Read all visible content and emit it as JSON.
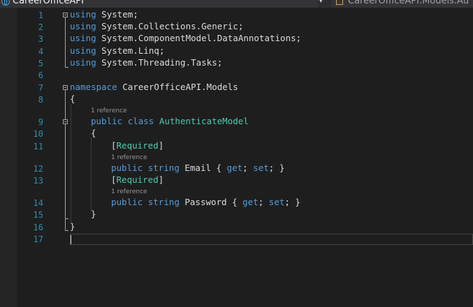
{
  "nav": {
    "project": "CareerOfficeAPI",
    "member": "CareerOfficeAPI.Models.Au"
  },
  "gutter": [
    "1",
    "2",
    "3",
    "4",
    "5",
    "6",
    "7",
    "8",
    "9",
    "10",
    "11",
    "12",
    "13",
    "14",
    "15",
    "16",
    "17"
  ],
  "code": {
    "l1": {
      "kw": "using",
      "rest": " System;"
    },
    "l2": {
      "kw": "using",
      "rest": " System.Collections.Generic;"
    },
    "l3": {
      "kw": "using",
      "rest": " System.ComponentModel.DataAnnotations;"
    },
    "l4": {
      "kw": "using",
      "rest": " System.Linq;"
    },
    "l5": {
      "kw": "using",
      "rest": " System.Threading.Tasks;"
    },
    "l7": {
      "kw": "namespace",
      "rest": " CareerOfficeAPI.Models"
    },
    "l8": {
      "text": "{"
    },
    "l9": {
      "kw1": "public",
      "kw2": "class",
      "type": "AuthenticateModel"
    },
    "l10": {
      "text": "{"
    },
    "l11": {
      "open": "[",
      "attr": "Required",
      "close": "]"
    },
    "l12": {
      "kw1": "public",
      "kw2": "string",
      "name": " Email { ",
      "get": "get",
      "mid": "; ",
      "set": "set",
      "end": "; }"
    },
    "l13": {
      "open": "[",
      "attr": "Required",
      "close": "]"
    },
    "l14": {
      "kw1": "public",
      "kw2": "string",
      "name": " Password { ",
      "get": "get",
      "mid": "; ",
      "set": "set",
      "end": "; }"
    },
    "l15": {
      "text": "}"
    },
    "l16": {
      "text": "}"
    }
  },
  "lens": {
    "class_refs": "1 reference",
    "email_refs": "1 reference",
    "password_refs": "1 reference"
  },
  "colors": {
    "keyword": "#569cd6",
    "type": "#4ec9b0",
    "line_number": "#2b91af",
    "text": "#dcdcdc",
    "background": "#1e1e1e"
  }
}
